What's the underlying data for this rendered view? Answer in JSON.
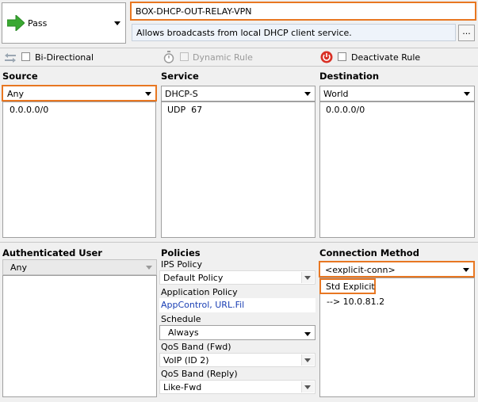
{
  "action": {
    "label": "Pass",
    "icon": "green-right-arrow-icon"
  },
  "rule": {
    "name": "BOX-DHCP-OUT-RELAY-VPN",
    "description": "Allows broadcasts from local DHCP client service.",
    "more_button": "..."
  },
  "options": {
    "bidirectional": "Bi-Directional",
    "dynamic_rule": "Dynamic Rule",
    "deactivate_rule": "Deactivate Rule"
  },
  "source": {
    "title": "Source",
    "selected": "Any",
    "items": [
      "0.0.0.0/0"
    ]
  },
  "service": {
    "title": "Service",
    "selected": "DHCP-S",
    "items": [
      "UDP  67"
    ]
  },
  "destination": {
    "title": "Destination",
    "selected": "World",
    "items": [
      "0.0.0.0/0"
    ]
  },
  "auth_user": {
    "title": "Authenticated User",
    "selected": "Any"
  },
  "policies": {
    "title": "Policies",
    "ips_label": "IPS Policy",
    "ips_value": "Default Policy",
    "app_label": "Application Policy",
    "app_value": "AppControl, URL.Fil",
    "schedule_label": "Schedule",
    "schedule_value": "Always",
    "qos_fwd_label": "QoS Band (Fwd)",
    "qos_fwd_value": "VoIP (ID 2)",
    "qos_reply_label": "QoS Band (Reply)",
    "qos_reply_value": "Like-Fwd"
  },
  "connection": {
    "title": "Connection Method",
    "selected": "<explicit-conn>",
    "item_title": "Std Explicit",
    "item_detail": "--> 10.0.81.2"
  },
  "colors": {
    "highlight": "#e87722",
    "link": "#1a3fb4",
    "pass_arrow": "#3aa832"
  }
}
